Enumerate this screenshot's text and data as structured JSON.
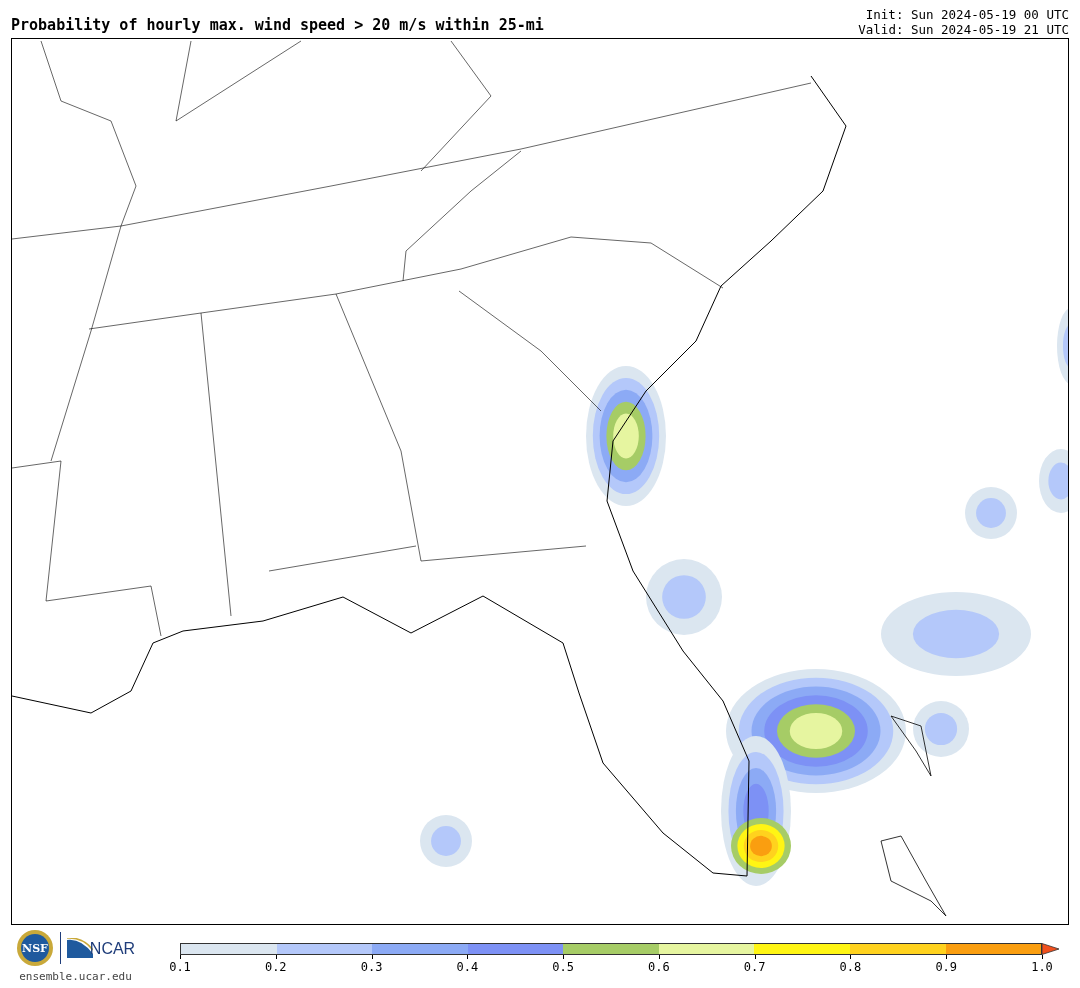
{
  "title": "Probability of hourly max. wind speed > 20 m/s within 25-mi",
  "init": "Init: Sun 2024-05-19 00 UTC",
  "valid": "Valid: Sun 2024-05-19 21 UTC",
  "logos": {
    "nsf": "NSF",
    "ncar": "NCAR",
    "site": "ensemble.ucar.edu"
  },
  "colorbar": {
    "bins": [
      {
        "color": "#dbe6f0"
      },
      {
        "color": "#b4c8fa"
      },
      {
        "color": "#8caaf5"
      },
      {
        "color": "#7d91f5"
      },
      {
        "color": "#a6cc66"
      },
      {
        "color": "#e6f5a0"
      },
      {
        "color": "#fff514"
      },
      {
        "color": "#ffd21e"
      },
      {
        "color": "#fa9e10"
      }
    ],
    "extend": {
      "color": "#f0501e"
    },
    "ticks": [
      "0.1",
      "0.2",
      "0.3",
      "0.4",
      "0.5",
      "0.6",
      "0.7",
      "0.8",
      "0.9",
      "1.0"
    ]
  }
}
